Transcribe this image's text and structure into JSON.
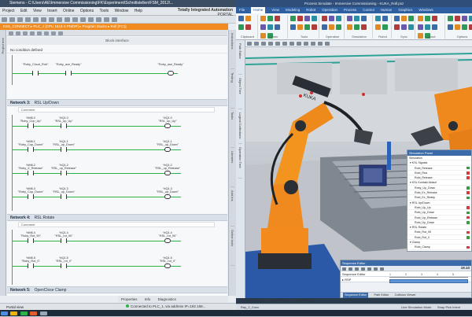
{
  "tia": {
    "title": "Siemens - C:\\Users\\AE\\Immersive Commissioning\\FK\\Experiment\\Schnittstellen\\FSM_2012\\...",
    "menu": [
      "Project",
      "Edit",
      "View",
      "Insert",
      "Online",
      "Options",
      "Tools",
      "Window",
      "Help"
    ],
    "brand_line1": "Totally Integrated Automation",
    "brand_line2": "PORTAL",
    "breadcrumb": "KSS_CONNECT ▸ PLC_1 [CPU 1516-3 PN/DP] ▸ Program blocks ▸ Roll [FC1]",
    "left_tab": "Project tree",
    "right_tabs": [
      "Instructions",
      "Testing",
      "Tasks",
      "Libraries",
      "Add-ins",
      "Online tools"
    ],
    "block_header": "Block interface",
    "comment_line": "No condition defined",
    "networks": [
      {
        "num": "Network 3:",
        "title": "RSL Up/Down",
        "comment": "Comment"
      },
      {
        "num": "Network 4:",
        "title": "RSL Rotate",
        "comment": "Comment"
      },
      {
        "num": "Network 5:",
        "title": "OpenClose Clamp"
      }
    ],
    "net2_tags": {
      "c1": "\"Roby_Cloud_Rob\"",
      "c2": "\"Roby_ace_Ready\"",
      "coil": "\"Roby_ase_Ready\""
    },
    "net3_rows": [
      {
        "a_addr": "%M6.0",
        "a": "\"Roby_Cup_Up\"",
        "b_addr": "%Q1.0",
        "b": "\"RSL_up_Up\"",
        "c_addr": "%Q1.0",
        "c": "\"RSL_up_Up\""
      },
      {
        "a_addr": "%M6.1",
        "a": "\"Roby_Cup_Down\"",
        "b_addr": "%Q1.1",
        "b": "\"RSL_up_Down\"",
        "c_addr": "%Q1.1",
        "c": "\"RSL_up_Down\""
      },
      {
        "a_addr": "%M6.2",
        "a": "\"Roby_Z_Release\"",
        "b_addr": "%Q1.2",
        "b": "\"RSL_up_Release\"",
        "c_addr": "%Q1.2",
        "c": "\"RSL_up_Release\""
      },
      {
        "a_addr": "%M6.3",
        "a": "\"Roby_Cup_Down\"",
        "b_addr": "%Q1.3",
        "b": "\"RSL_up_Down\"",
        "c_addr": "%Q1.3",
        "c": "\"RSL_up_Down\""
      }
    ],
    "net4_rows": [
      {
        "a_addr": "%M6.4",
        "a": "\"Roby_Rot_90\"",
        "b_addr": "%Q1.4",
        "b": "\"RSL_rot_90\"",
        "c_addr": "%Q1.4",
        "c": "\"RSL_rot_90\""
      },
      {
        "a_addr": "%M6.5",
        "a": "\"Roby_Rot_0\"",
        "b_addr": "%Q1.5",
        "b": "\"RSL_rot_0\"",
        "c_addr": "%Q1.5",
        "c": "\"RSL_rot_0\""
      }
    ],
    "bottom_tabs": [
      "Properties",
      "Info",
      "Diagnostics"
    ],
    "portal_view": "Portal view",
    "status_msg": "Connected to PLC_1, via address IP=192.168..."
  },
  "ps": {
    "title": "Process Simulate - Immersive Commissioning - KUKA_Roll.psz",
    "tabs": [
      "File",
      "Home",
      "View",
      "Modeling",
      "Robot",
      "Operation",
      "Process",
      "Control",
      "Human",
      "Graphics",
      "Windows"
    ],
    "active_tab": "Home",
    "ribbon_groups": [
      "Clipboard",
      "Viewer",
      "Tools",
      "Operation",
      "Simulation",
      "Robot",
      "Sync",
      "Layout",
      "Options"
    ],
    "left_tabs": [
      "Path Editor",
      "Object Tree",
      "Logical Collections",
      "Operation Tree"
    ],
    "tree_title": "Simulation Panel",
    "tree_rows": [
      {
        "label": "Simulation",
        "color": ""
      },
      {
        "label": "▾ KSL Signals",
        "color": ""
      },
      {
        "label": "Robi_Release",
        "color": "#3c9b3c"
      },
      {
        "label": "Robi_Rea",
        "color": "#d23c3c"
      },
      {
        "label": "Robi_Release",
        "color": "#d23c3c"
      },
      {
        "label": "▾ KSL Kontakt Ablauf",
        "color": ""
      },
      {
        "label": "Roby_Up_Down",
        "color": "#3c9b3c"
      },
      {
        "label": "Robi_Ex_Release",
        "color": "#d23c3c"
      },
      {
        "label": "Robi_Ex_Ready",
        "color": "#3c9b3c"
      },
      {
        "label": "▾ RSL Up/Down",
        "color": ""
      },
      {
        "label": "Robi_Up_Up",
        "color": "#d23c3c"
      },
      {
        "label": "Robi_Up_Down",
        "color": "#3c9b3c"
      },
      {
        "label": "Robi_Up_Release",
        "color": "#d23c3c"
      },
      {
        "label": "Robi_Up_Down",
        "color": "#3c9b3c"
      },
      {
        "label": "▾ RSL Rotate",
        "color": ""
      },
      {
        "label": "Robi_Rot_90",
        "color": "#d23c3c"
      },
      {
        "label": "Robi_Rot_0",
        "color": "#3c9b3c"
      },
      {
        "label": "▾ Clamp",
        "color": ""
      },
      {
        "label": "Robi_Clamp",
        "color": "#d23c3c"
      }
    ],
    "seq_title": "Sequence Editor",
    "seq_time": "19.10",
    "seq_row1": "Sequence Editor",
    "seq_row2": "▸ RSP",
    "seq_ruler": [
      "1",
      "2",
      "3",
      "4",
      "5"
    ],
    "seq_bottom_tabs": [
      "Sequence Editor",
      "Path Editor",
      "Collision Viewer"
    ],
    "bottom_tabs": [
      "Path Editor",
      "Collision Viewer",
      "Signal Viewer"
    ],
    "status_left": "Ray_2_Conv",
    "status_mid": "Line Simulation Mode",
    "status_right": "Snap Pick Intent",
    "robot_label": "KUKA"
  },
  "colors": {
    "tia_orange": "#f08b1f",
    "ladder_green": "#2bb34a",
    "ps_blue": "#2e5fa0",
    "robot_orange": "#e8841f"
  }
}
